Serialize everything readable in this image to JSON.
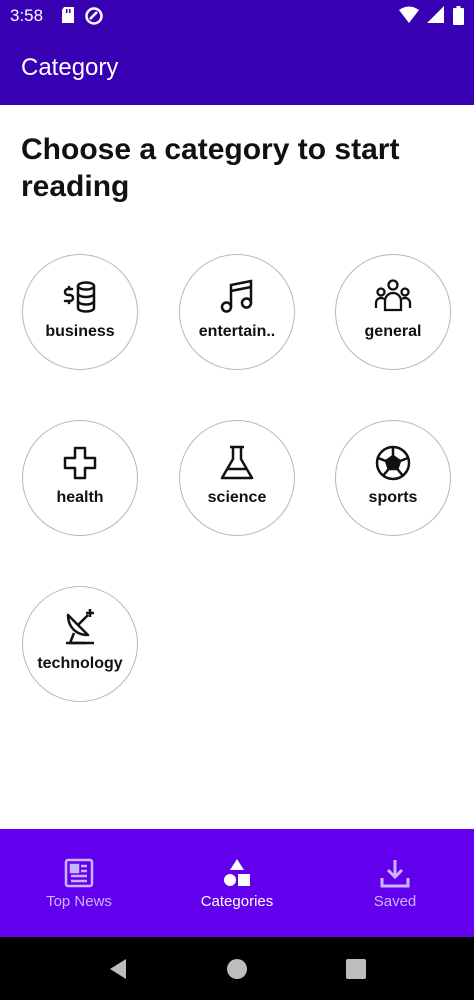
{
  "status_bar": {
    "time": "3:58",
    "icons": [
      "sd-card-icon",
      "data-saver-icon",
      "wifi-icon",
      "signal-icon",
      "battery-icon"
    ]
  },
  "app_bar": {
    "title": "Category"
  },
  "heading": "Choose a category to start reading",
  "categories": [
    {
      "label": "business",
      "icon": "money-coins-icon"
    },
    {
      "label": "entertain..",
      "icon": "music-note-icon"
    },
    {
      "label": "general",
      "icon": "people-group-icon"
    },
    {
      "label": "health",
      "icon": "medical-cross-icon"
    },
    {
      "label": "science",
      "icon": "flask-icon"
    },
    {
      "label": "sports",
      "icon": "soccer-ball-icon"
    },
    {
      "label": "technology",
      "icon": "satellite-dish-icon"
    }
  ],
  "bottom_nav": {
    "items": [
      {
        "label": "Top News",
        "icon": "newspaper-icon",
        "active": false
      },
      {
        "label": "Categories",
        "icon": "shapes-icon",
        "active": true
      },
      {
        "label": "Saved",
        "icon": "download-icon",
        "active": false
      }
    ]
  },
  "colors": {
    "app_bar": "#3700b3",
    "bottom_nav": "#6200ee",
    "nav_active": "#ffffff",
    "nav_inactive": "#c9b5ff"
  }
}
